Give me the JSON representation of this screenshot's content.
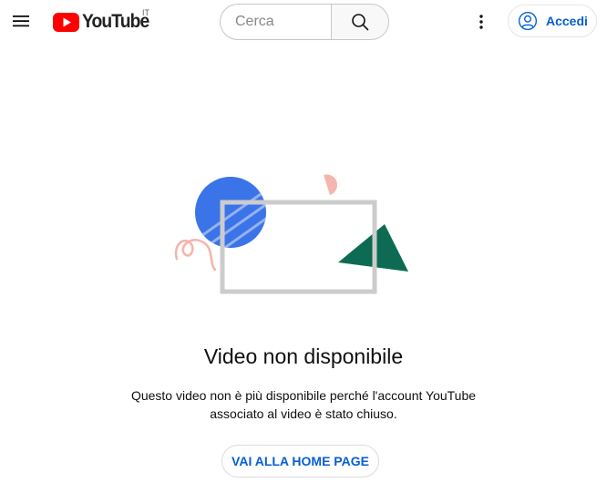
{
  "header": {
    "logo_text": "YouTube",
    "country_code": "IT",
    "search_placeholder": "Cerca",
    "signin_label": "Accedi"
  },
  "error": {
    "title": "Video non disponibile",
    "description": "Questo video non è più disponibile perché l'account YouTube associato al video è stato chiuso.",
    "home_button_label": "VAI ALLA HOME PAGE"
  },
  "colors": {
    "brand_red": "#ff0000",
    "link_blue": "#065fd4",
    "illustration_blue": "#3b74e8",
    "illustration_green": "#0d6b54",
    "illustration_pink": "#f4b6ae",
    "illustration_frame": "#cccccc"
  }
}
